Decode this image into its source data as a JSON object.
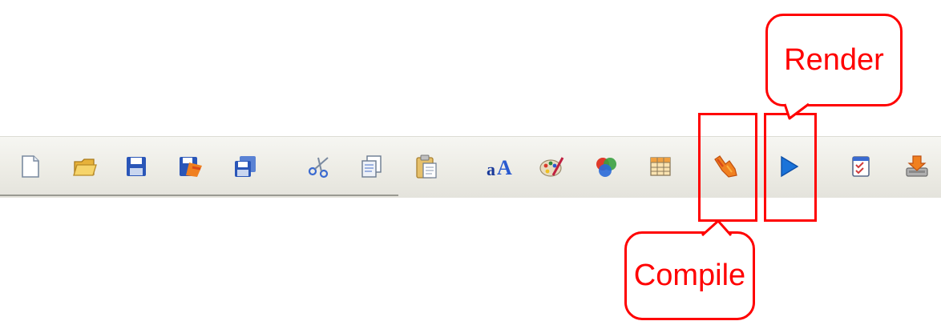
{
  "toolbar": {
    "buttons": [
      {
        "name": "new-document-icon"
      },
      {
        "name": "open-folder-icon"
      },
      {
        "name": "save-icon"
      },
      {
        "name": "save-as-icon"
      },
      {
        "name": "save-all-icon"
      },
      {
        "name": "cut-icon"
      },
      {
        "name": "copy-icon"
      },
      {
        "name": "paste-icon"
      },
      {
        "name": "font-icon"
      },
      {
        "name": "color-palette-icon"
      },
      {
        "name": "shapes-icon"
      },
      {
        "name": "table-grid-icon"
      },
      {
        "name": "compile-icon"
      },
      {
        "name": "render-play-icon"
      },
      {
        "name": "checklist-icon"
      },
      {
        "name": "install-icon"
      }
    ]
  },
  "callouts": {
    "render_label": "Render",
    "compile_label": "Compile"
  },
  "colors": {
    "callout": "#ff0000",
    "render_blue": "#1a73d9",
    "compile_orange": "#f08020"
  }
}
